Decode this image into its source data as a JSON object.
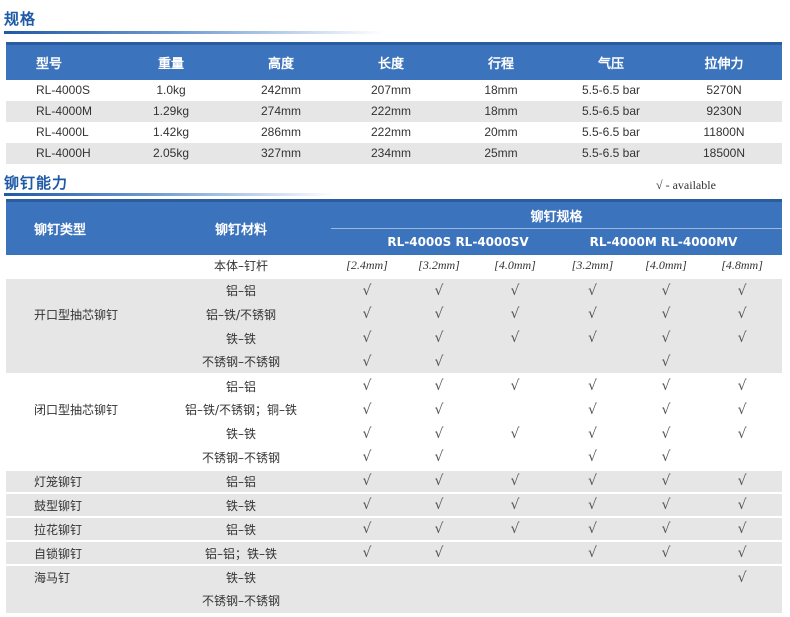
{
  "spec_section": {
    "title": "规格",
    "headers": [
      "型号",
      "重量",
      "高度",
      "长度",
      "行程",
      "气压",
      "拉伸力"
    ],
    "rows": [
      [
        "RL-4000S",
        "1.0kg",
        "242mm",
        "207mm",
        "18mm",
        "5.5-6.5 bar",
        "5270N"
      ],
      [
        "RL-4000M",
        "1.29kg",
        "274mm",
        "222mm",
        "18mm",
        "5.5-6.5 bar",
        "9230N"
      ],
      [
        "RL-4000L",
        "1.42kg",
        "286mm",
        "222mm",
        "20mm",
        "5.5-6.5 bar",
        "11800N"
      ],
      [
        "RL-4000H",
        "2.05kg",
        "327mm",
        "234mm",
        "25mm",
        "5.5-6.5 bar",
        "18500N"
      ]
    ]
  },
  "capability_section": {
    "title": "铆钉能力",
    "legend": "√ - available",
    "header_type": "铆钉类型",
    "header_material": "铆钉材料",
    "header_specs": "铆钉规格",
    "models_left": "RL-4000S  RL-4000SV",
    "models_right": "RL-4000M  RL-4000MV",
    "size_label": "本体–钉杆",
    "sizes": [
      "[2.4mm]",
      "[3.2mm]",
      "[4.0mm]",
      "[3.2mm]",
      "[4.0mm]",
      "[4.8mm]"
    ],
    "check_mark": "√",
    "rows": [
      {
        "type": "",
        "material": "铝–铝",
        "checks": [
          1,
          1,
          1,
          1,
          1,
          1
        ],
        "group": "a",
        "first": true
      },
      {
        "type": "开口型抽芯铆钉",
        "material": "铝–铁/不锈钢",
        "checks": [
          1,
          1,
          1,
          1,
          1,
          1
        ],
        "group": "a"
      },
      {
        "type": "",
        "material": "铁–铁",
        "checks": [
          1,
          1,
          1,
          1,
          1,
          1
        ],
        "group": "a"
      },
      {
        "type": "",
        "material": "不锈钢–不锈钢",
        "checks": [
          1,
          1,
          0,
          0,
          1,
          0
        ],
        "group": "a"
      },
      {
        "type": "",
        "material": "铝–铝",
        "checks": [
          1,
          1,
          1,
          1,
          1,
          1
        ],
        "group": "b",
        "first": true
      },
      {
        "type": "闭口型抽芯铆钉",
        "material": "铝–铁/不锈钢；铜–铁",
        "checks": [
          1,
          1,
          0,
          1,
          1,
          1
        ],
        "group": "b"
      },
      {
        "type": "",
        "material": "铁–铁",
        "checks": [
          1,
          1,
          1,
          1,
          1,
          1
        ],
        "group": "b"
      },
      {
        "type": "",
        "material": "不锈钢–不锈钢",
        "checks": [
          1,
          1,
          0,
          1,
          1,
          0
        ],
        "group": "b"
      },
      {
        "type": "灯笼铆钉",
        "material": "铝–铝",
        "checks": [
          1,
          1,
          1,
          1,
          1,
          1
        ],
        "group": "c",
        "first": true
      },
      {
        "type": "鼓型铆钉",
        "material": "铁–铁",
        "checks": [
          1,
          1,
          1,
          1,
          1,
          1
        ],
        "group": "c",
        "first": true
      },
      {
        "type": "拉花铆钉",
        "material": "铝–铁",
        "checks": [
          1,
          1,
          1,
          1,
          1,
          1
        ],
        "group": "c",
        "first": true
      },
      {
        "type": "自锁铆钉",
        "material": "铝–铝；铁–铁",
        "checks": [
          1,
          1,
          0,
          1,
          1,
          1
        ],
        "group": "c",
        "first": true
      },
      {
        "type": "海马钉",
        "material": "铁–铁",
        "checks": [
          0,
          0,
          0,
          0,
          0,
          1
        ],
        "group": "c",
        "first": true
      },
      {
        "type": "",
        "material": "不锈钢–不锈钢",
        "checks": [
          0,
          0,
          0,
          0,
          0,
          0
        ],
        "group": "c"
      }
    ]
  }
}
